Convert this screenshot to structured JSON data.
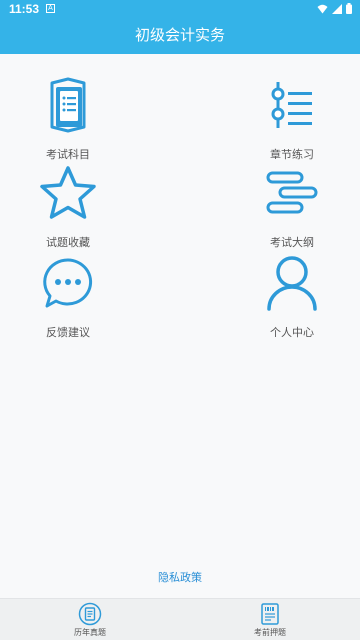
{
  "status_bar": {
    "time": "11:53",
    "notification_icon": "A"
  },
  "header": {
    "title": "初级会计实务"
  },
  "menu": {
    "exam_subjects": {
      "label": "考试科目",
      "icon": "book-icon"
    },
    "chapter_practice": {
      "label": "章节练习",
      "icon": "timeline-list-icon"
    },
    "favorites": {
      "label": "试题收藏",
      "icon": "star-icon"
    },
    "syllabus": {
      "label": "考试大纲",
      "icon": "outline-bars-icon"
    },
    "feedback": {
      "label": "反馈建议",
      "icon": "chat-bubble-icon"
    },
    "profile": {
      "label": "个人中心",
      "icon": "person-icon"
    }
  },
  "footer": {
    "privacy_link": "隐私政策"
  },
  "bottom_nav": {
    "past_exams": {
      "label": "历年真题",
      "icon": "exam-paper-icon"
    },
    "pre_exam": {
      "label": "考前押题",
      "icon": "barcode-doc-icon"
    }
  },
  "colors": {
    "primary": "#34b3e8",
    "icon_blue": "#2e9ad8",
    "link": "#2a8fd6"
  }
}
